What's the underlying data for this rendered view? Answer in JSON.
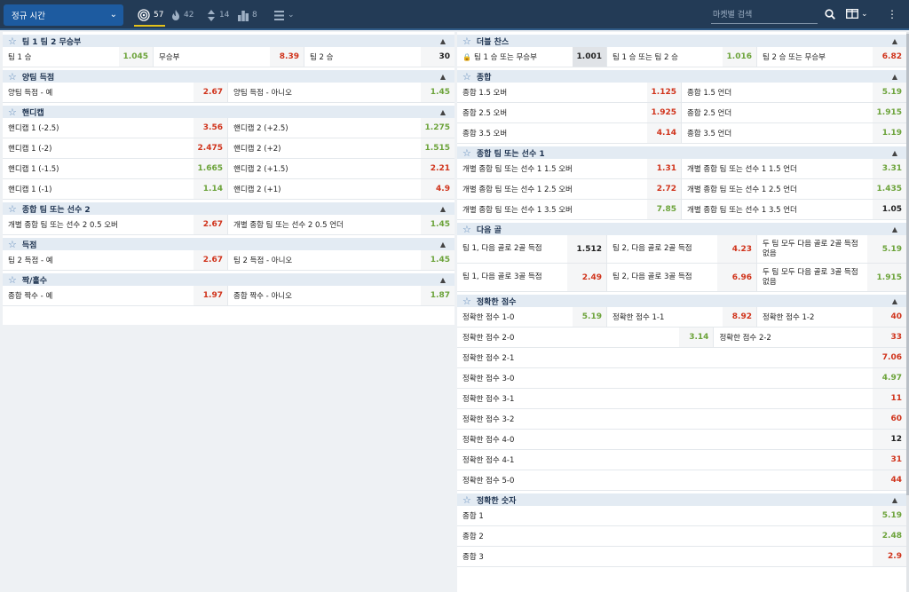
{
  "topbar": {
    "period": "정규 시간",
    "filters": [
      {
        "icon": "target-icon",
        "count": "57",
        "active": true
      },
      {
        "icon": "fire-icon",
        "count": "42",
        "active": false
      },
      {
        "icon": "updown-arrows-icon",
        "count": "14",
        "active": false
      },
      {
        "icon": "podium-icon",
        "count": "8",
        "active": false
      },
      {
        "icon": "list-menu-icon",
        "count": "",
        "active": false
      }
    ],
    "search_placeholder": "마켓별 검색"
  },
  "left": [
    {
      "title": "팀 1 팀 2 무승부",
      "rows": [
        [
          {
            "label": "팀 1 승",
            "odd": "1.045",
            "trend": "up"
          },
          {
            "label": "무승부",
            "odd": "8.39",
            "trend": "down"
          },
          {
            "label": "팀 2 승",
            "odd": "30",
            "trend": "neu"
          }
        ]
      ]
    },
    {
      "title": "양팀 득점",
      "rows": [
        [
          {
            "label": "양팀 득점 - 예",
            "odd": "2.67",
            "trend": "down"
          },
          {
            "label": "양팀 득점 - 아니오",
            "odd": "1.45",
            "trend": "up"
          }
        ]
      ]
    },
    {
      "title": "핸디캡",
      "rows": [
        [
          {
            "label": "핸디캡 1 (-2.5)",
            "odd": "3.56",
            "trend": "down"
          },
          {
            "label": "핸디캡 2 (+2.5)",
            "odd": "1.275",
            "trend": "up"
          }
        ],
        [
          {
            "label": "핸디캡 1 (-2)",
            "odd": "2.475",
            "trend": "down"
          },
          {
            "label": "핸디캡 2 (+2)",
            "odd": "1.515",
            "trend": "up"
          }
        ],
        [
          {
            "label": "핸디캡 1 (-1.5)",
            "odd": "1.665",
            "trend": "up"
          },
          {
            "label": "핸디캡 2 (+1.5)",
            "odd": "2.21",
            "trend": "down"
          }
        ],
        [
          {
            "label": "핸디캡 1 (-1)",
            "odd": "1.14",
            "trend": "up"
          },
          {
            "label": "핸디캡 2 (+1)",
            "odd": "4.9",
            "trend": "down"
          }
        ]
      ]
    },
    {
      "title": "종합 팀 또는 선수 2",
      "rows": [
        [
          {
            "label": "개별 종합 팀 또는 선수 2 0.5 오버",
            "odd": "2.67",
            "trend": "down"
          },
          {
            "label": "개별 종합 팀 또는 선수 2 0.5 언더",
            "odd": "1.45",
            "trend": "up"
          }
        ]
      ]
    },
    {
      "title": "득점",
      "rows": [
        [
          {
            "label": "팀 2 득점 - 예",
            "odd": "2.67",
            "trend": "down"
          },
          {
            "label": "팀 2 득점 - 아니오",
            "odd": "1.45",
            "trend": "up"
          }
        ]
      ]
    },
    {
      "title": "짝/홀수",
      "rows": [
        [
          {
            "label": "종합 짝수 - 예",
            "odd": "1.97",
            "trend": "down"
          },
          {
            "label": "종합 짝수 - 아니오",
            "odd": "1.87",
            "trend": "up"
          }
        ]
      ]
    }
  ],
  "right": [
    {
      "title": "더블 찬스",
      "rows": [
        [
          {
            "label": "팀 1 승 또는 무승부",
            "odd": "1.001",
            "trend": "neu",
            "locked": true
          },
          {
            "label": "팀 1 승 또는 팀 2 승",
            "odd": "1.016",
            "trend": "up"
          },
          {
            "label": "팀 2 승 또는 무승부",
            "odd": "6.82",
            "trend": "down"
          }
        ]
      ]
    },
    {
      "title": "종합",
      "rows": [
        [
          {
            "label": "종합 1.5 오버",
            "odd": "1.125",
            "trend": "down"
          },
          {
            "label": "종합 1.5 언더",
            "odd": "5.19",
            "trend": "up"
          }
        ],
        [
          {
            "label": "종합 2.5 오버",
            "odd": "1.925",
            "trend": "down"
          },
          {
            "label": "종합 2.5 언더",
            "odd": "1.915",
            "trend": "up"
          }
        ],
        [
          {
            "label": "종합 3.5 오버",
            "odd": "4.14",
            "trend": "down"
          },
          {
            "label": "종합 3.5 언더",
            "odd": "1.19",
            "trend": "up"
          }
        ]
      ]
    },
    {
      "title": "종합 팀 또는 선수 1",
      "rows": [
        [
          {
            "label": "개별 종합 팀 또는 선수 1 1.5 오버",
            "odd": "1.31",
            "trend": "down"
          },
          {
            "label": "개별 종합 팀 또는 선수 1 1.5 언더",
            "odd": "3.31",
            "trend": "up"
          }
        ],
        [
          {
            "label": "개별 종합 팀 또는 선수 1 2.5 오버",
            "odd": "2.72",
            "trend": "down"
          },
          {
            "label": "개별 종합 팀 또는 선수 1 2.5 언더",
            "odd": "1.435",
            "trend": "up"
          }
        ],
        [
          {
            "label": "개별 종합 팀 또는 선수 1 3.5 오버",
            "odd": "7.85",
            "trend": "up"
          },
          {
            "label": "개별 종합 팀 또는 선수 1 3.5 언더",
            "odd": "1.05",
            "trend": "neu"
          }
        ]
      ]
    },
    {
      "title": "다음 골",
      "tall": true,
      "rows": [
        [
          {
            "label": "팀 1, 다음 골로 2골 득점",
            "odd": "1.512",
            "trend": "neu"
          },
          {
            "label": "팀 2, 다음 골로 2골 득점",
            "odd": "4.23",
            "trend": "down"
          },
          {
            "label": "두 팀 모두 다음 골로 2골 득점 없음",
            "odd": "5.19",
            "trend": "up"
          }
        ],
        [
          {
            "label": "팀 1, 다음 골로 3골 득점",
            "odd": "2.49",
            "trend": "down"
          },
          {
            "label": "팀 2, 다음 골로 3골 득점",
            "odd": "6.96",
            "trend": "down"
          },
          {
            "label": "두 팀 모두 다음 골로 3골 득점 없음",
            "odd": "1.915",
            "trend": "up"
          }
        ]
      ]
    },
    {
      "title": "정확한 점수",
      "rows": [
        [
          {
            "label": "정확한 점수 1-0",
            "odd": "5.19",
            "trend": "up"
          },
          {
            "label": "정확한 점수 1-1",
            "odd": "8.92",
            "trend": "down"
          },
          {
            "label": "정확한 점수 1-2",
            "odd": "40",
            "trend": "down"
          }
        ],
        [
          {
            "label": "정확한 점수 2-0",
            "odd": "3.14",
            "trend": "up",
            "span": 2
          },
          {
            "label": "정확한 점수 2-2",
            "odd": "33",
            "trend": "down"
          }
        ],
        [
          {
            "label": "정확한 점수 2-1",
            "odd": "7.06",
            "trend": "down",
            "span": 3
          }
        ],
        [
          {
            "label": "정확한 점수 3-0",
            "odd": "4.97",
            "trend": "up",
            "span": 3
          }
        ],
        [
          {
            "label": "정확한 점수 3-1",
            "odd": "11",
            "trend": "down",
            "span": 3
          }
        ],
        [
          {
            "label": "정확한 점수 3-2",
            "odd": "60",
            "trend": "down",
            "span": 3
          }
        ],
        [
          {
            "label": "정확한 점수 4-0",
            "odd": "12",
            "trend": "neu",
            "span": 3
          }
        ],
        [
          {
            "label": "정확한 점수 4-1",
            "odd": "31",
            "trend": "down",
            "span": 3
          }
        ],
        [
          {
            "label": "정확한 점수 5-0",
            "odd": "44",
            "trend": "down",
            "span": 3
          }
        ]
      ]
    },
    {
      "title": "정확한 숫자",
      "rows": [
        [
          {
            "label": "종합 1",
            "odd": "5.19",
            "trend": "up",
            "span": 3
          }
        ],
        [
          {
            "label": "종합 2",
            "odd": "2.48",
            "trend": "up",
            "span": 3
          }
        ],
        [
          {
            "label": "종합 3",
            "odd": "2.9",
            "trend": "down",
            "span": 3
          }
        ]
      ]
    }
  ]
}
